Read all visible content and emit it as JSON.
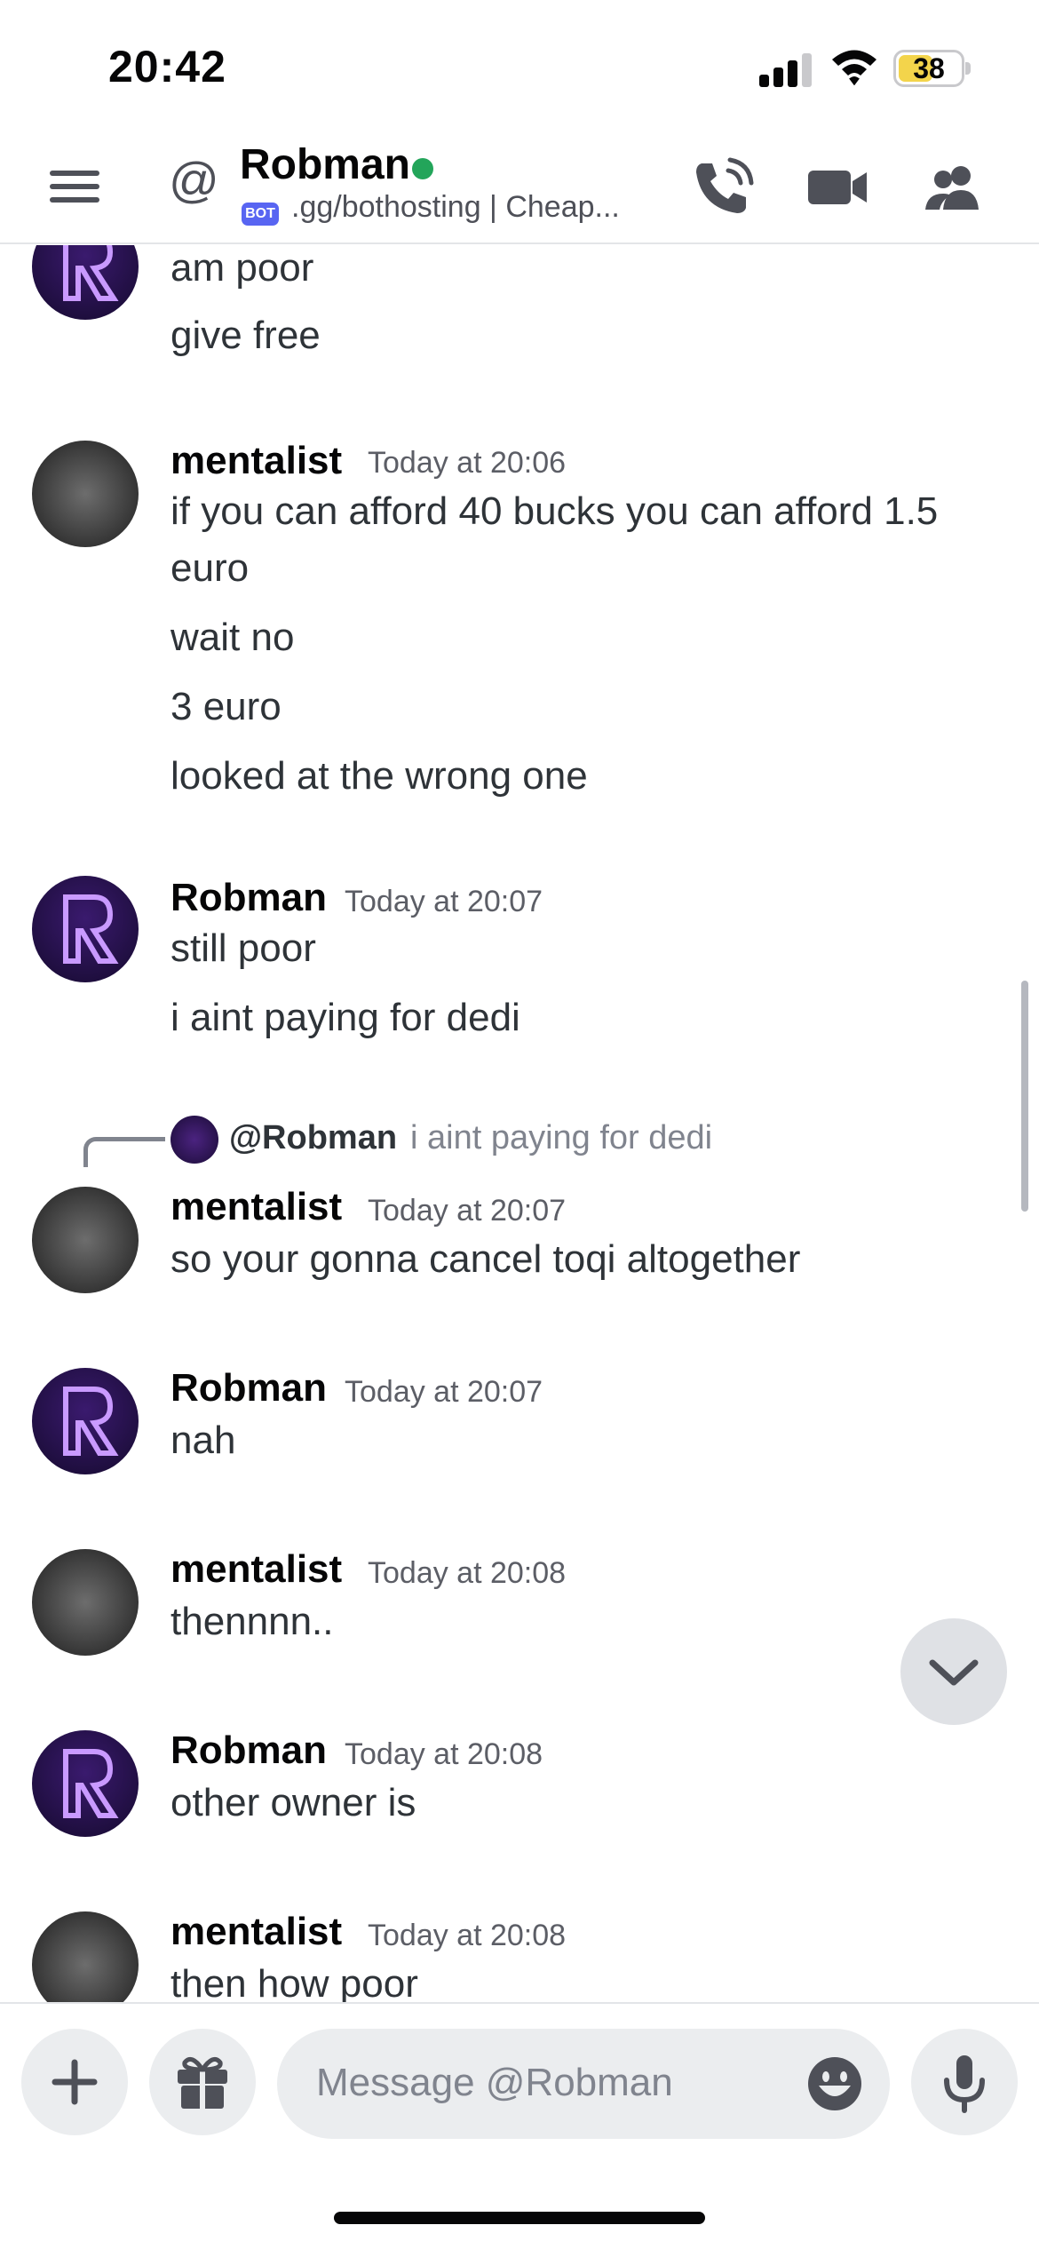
{
  "status_bar": {
    "time": "20:42",
    "battery": "38"
  },
  "header": {
    "at_symbol": "@",
    "name": "Robman",
    "bot_badge": "BOT",
    "subtitle": ".gg/bothosting | Cheap...",
    "icons": [
      "menu-icon",
      "voice-call-icon",
      "video-call-icon",
      "members-icon"
    ]
  },
  "messages": [
    {
      "author": "",
      "time": "",
      "lines": [
        "am poor",
        "give free"
      ]
    },
    {
      "author": "mentalist",
      "time": "Today at 20:06",
      "lines": [
        "if you can afford 40 bucks you can afford 1.5",
        "euro",
        "wait no",
        "3 euro",
        "looked at the wrong one"
      ]
    },
    {
      "author": "Robman",
      "time": "Today at 20:07",
      "lines": [
        "still poor",
        "i aint paying for dedi"
      ]
    },
    {
      "author": "mentalist",
      "time": "Today at 20:07",
      "reply": {
        "name": "@Robman",
        "text": "i aint paying for dedi"
      },
      "lines": [
        "so your gonna cancel toqi altogether"
      ]
    },
    {
      "author": "Robman",
      "time": "Today at 20:07",
      "lines": [
        "nah"
      ]
    },
    {
      "author": "mentalist",
      "time": "Today at 20:08",
      "lines": [
        "thennnn.."
      ]
    },
    {
      "author": "Robman",
      "time": "Today at 20:08",
      "lines": [
        "other owner is"
      ]
    },
    {
      "author": "mentalist",
      "time": "Today at 20:08",
      "lines": [
        "then how poor"
      ]
    }
  ],
  "composer": {
    "placeholder": "Message @Robman"
  }
}
